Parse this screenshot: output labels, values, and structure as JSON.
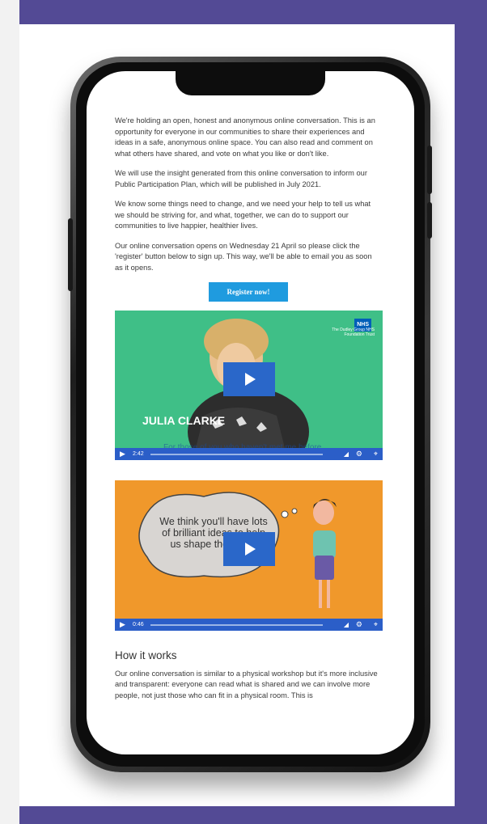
{
  "paragraphs": [
    "We're holding an open, honest and anonymous online conversation. This is an opportunity for everyone in our communities to share their experiences and ideas in a safe, anonymous online space. You can also read and comment on what others have shared, and vote on what you like or don't like.",
    "We will use the insight generated from this online conversation to inform our Public Participation Plan, which will be published in July 2021.",
    "We know some things need to change, and we need your help to tell us what we should be striving for, and what, together, we can do to support our communities to live happier, healthier lives.",
    "Our online conversation opens on Wednesday 21 April so please click the 'register' button below to sign up. This way, we'll be able to email you as soon as it opens."
  ],
  "register_button": "Register now!",
  "video1": {
    "badge": "NHS",
    "org": "The Dudley Group NHS Foundation Trust",
    "name_tag": "JULIA CLARKE",
    "caption": "For those of you who haven't met me before",
    "time": "2:42"
  },
  "video2": {
    "bubble_text": "We think you'll have lots of brilliant ideas to help us shape the future",
    "time": "0:46"
  },
  "how_heading": "How it works",
  "how_text": "Our online conversation is similar to a physical workshop but it's more inclusive and transparent: everyone can read what is shared and we can involve more people, not just those who can fit in a physical room. This is"
}
